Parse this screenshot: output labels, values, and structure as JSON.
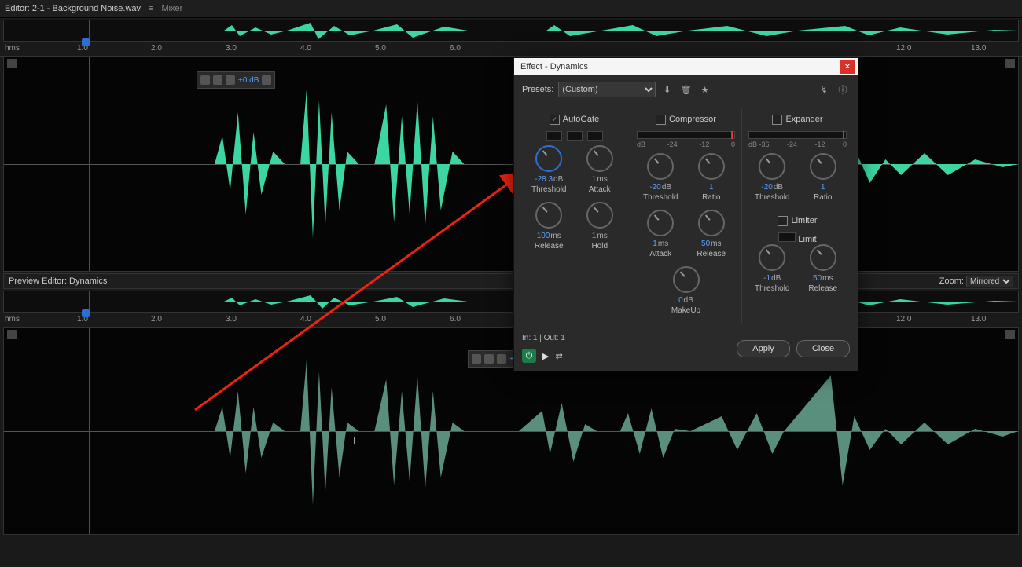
{
  "tabs": {
    "editor": "Editor: 2-1 - Background Noise.wav",
    "mixer": "Mixer"
  },
  "ruler": {
    "unit": "hms",
    "marks": [
      "1.0",
      "2.0",
      "3.0",
      "4.0",
      "5.0",
      "6.0",
      "12.0",
      "13.0"
    ]
  },
  "hud": {
    "gain": "+0 dB"
  },
  "preview": {
    "title": "Preview Editor: Dynamics",
    "zoom_label": "Zoom:",
    "zoom_value": "Mirrored"
  },
  "dialog": {
    "title": "Effect - Dynamics",
    "presets_label": "Presets:",
    "preset_value": "(Custom)",
    "io": "In: 1 | Out: 1",
    "apply": "Apply",
    "close": "Close",
    "autogate": {
      "label": "AutoGate",
      "checked": true,
      "threshold": {
        "v": "-28.3",
        "u": "dB",
        "l": "Threshold"
      },
      "attack": {
        "v": "1",
        "u": "ms",
        "l": "Attack"
      },
      "release": {
        "v": "100",
        "u": "ms",
        "l": "Release"
      },
      "hold": {
        "v": "1",
        "u": "ms",
        "l": "Hold"
      }
    },
    "compressor": {
      "label": "Compressor",
      "checked": false,
      "meter": [
        "dB",
        "-24",
        "-12",
        "0"
      ],
      "threshold": {
        "v": "-20",
        "u": "dB",
        "l": "Threshold"
      },
      "ratio": {
        "v": "1",
        "u": "",
        "l": "Ratio"
      },
      "attack": {
        "v": "1",
        "u": "ms",
        "l": "Attack"
      },
      "release": {
        "v": "50",
        "u": "ms",
        "l": "Release"
      },
      "makeup": {
        "v": "0",
        "u": "dB",
        "l": "MakeUp"
      }
    },
    "expander": {
      "label": "Expander",
      "checked": false,
      "meter": [
        "dB -36",
        "-24",
        "-12",
        "0"
      ],
      "threshold": {
        "v": "-20",
        "u": "dB",
        "l": "Threshold"
      },
      "ratio": {
        "v": "1",
        "u": "",
        "l": "Ratio"
      }
    },
    "limiter": {
      "label": "Limiter",
      "checked": false,
      "limit_label": "Limit",
      "threshold": {
        "v": "-1",
        "u": "dB",
        "l": "Threshold"
      },
      "release": {
        "v": "50",
        "u": "ms",
        "l": "Release"
      }
    }
  }
}
